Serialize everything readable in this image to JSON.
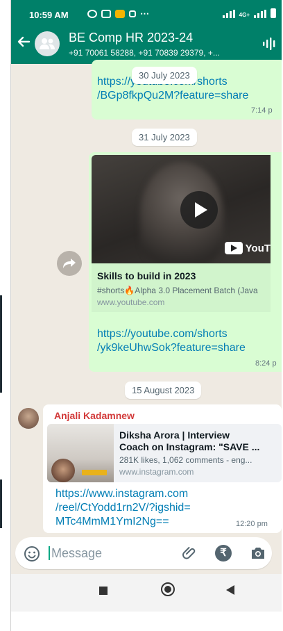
{
  "status_bar": {
    "time": "10:59 AM",
    "more": "⋯",
    "network": "4G+"
  },
  "header": {
    "title": "BE Comp HR 2023-24",
    "participants": "+91 70061 58288, +91 70839 29379, +...",
    "back_icon": "arrow-left-icon",
    "avatar_icon": "group-avatar-icon",
    "call_icon": "audio-wave-icon",
    "background": "#008069"
  },
  "messages": [
    {
      "date": "30 July 2023",
      "link_lines": [
        "https://youtube.com/shorts",
        "/BGp8fkpQu2M?feature=share"
      ],
      "time": "7:14 p"
    },
    {
      "date": "31 July 2023",
      "preview_title": "Skills to build in 2023",
      "preview_desc": "#shorts🔥Alpha 3.0 Placement Batch (Java",
      "preview_domain": "www.youtube.com",
      "video_brand": "YouT",
      "link_lines": [
        "https://youtube.com/shorts",
        "/yk9keUhwSok?feature=share"
      ],
      "time": "8:24 p"
    },
    {
      "date": "15 August 2023",
      "sender": "Anjali Kadamnew",
      "preview_title_lines": [
        "Diksha Arora | Interview",
        "Coach on Instagram: \"SAVE ..."
      ],
      "preview_desc": "281K likes, 1,062 comments - eng...",
      "preview_domain": "www.instagram.com",
      "link_lines": [
        "https://www.instagram.com",
        "/reel/CtYodd1rn2V/?igshid=",
        "MTc4MmM1YmI2Ng=="
      ],
      "time": "12:20 pm"
    }
  ],
  "composer": {
    "placeholder": "Message",
    "emoji_icon": "emoji-icon",
    "attach_icon": "paperclip-icon",
    "payment_icon": "rupee-icon",
    "rupee_symbol": "₹",
    "camera_icon": "camera-icon"
  },
  "navigation": {
    "recents_icon": "square-icon",
    "home_icon": "home-circle-icon",
    "back_icon": "triangle-back-icon"
  },
  "colors": {
    "chat_background": "#efeae2",
    "outgoing_bubble": "#d9fdd3",
    "link": "#027eb5",
    "sender_name": "#d23a3a"
  }
}
